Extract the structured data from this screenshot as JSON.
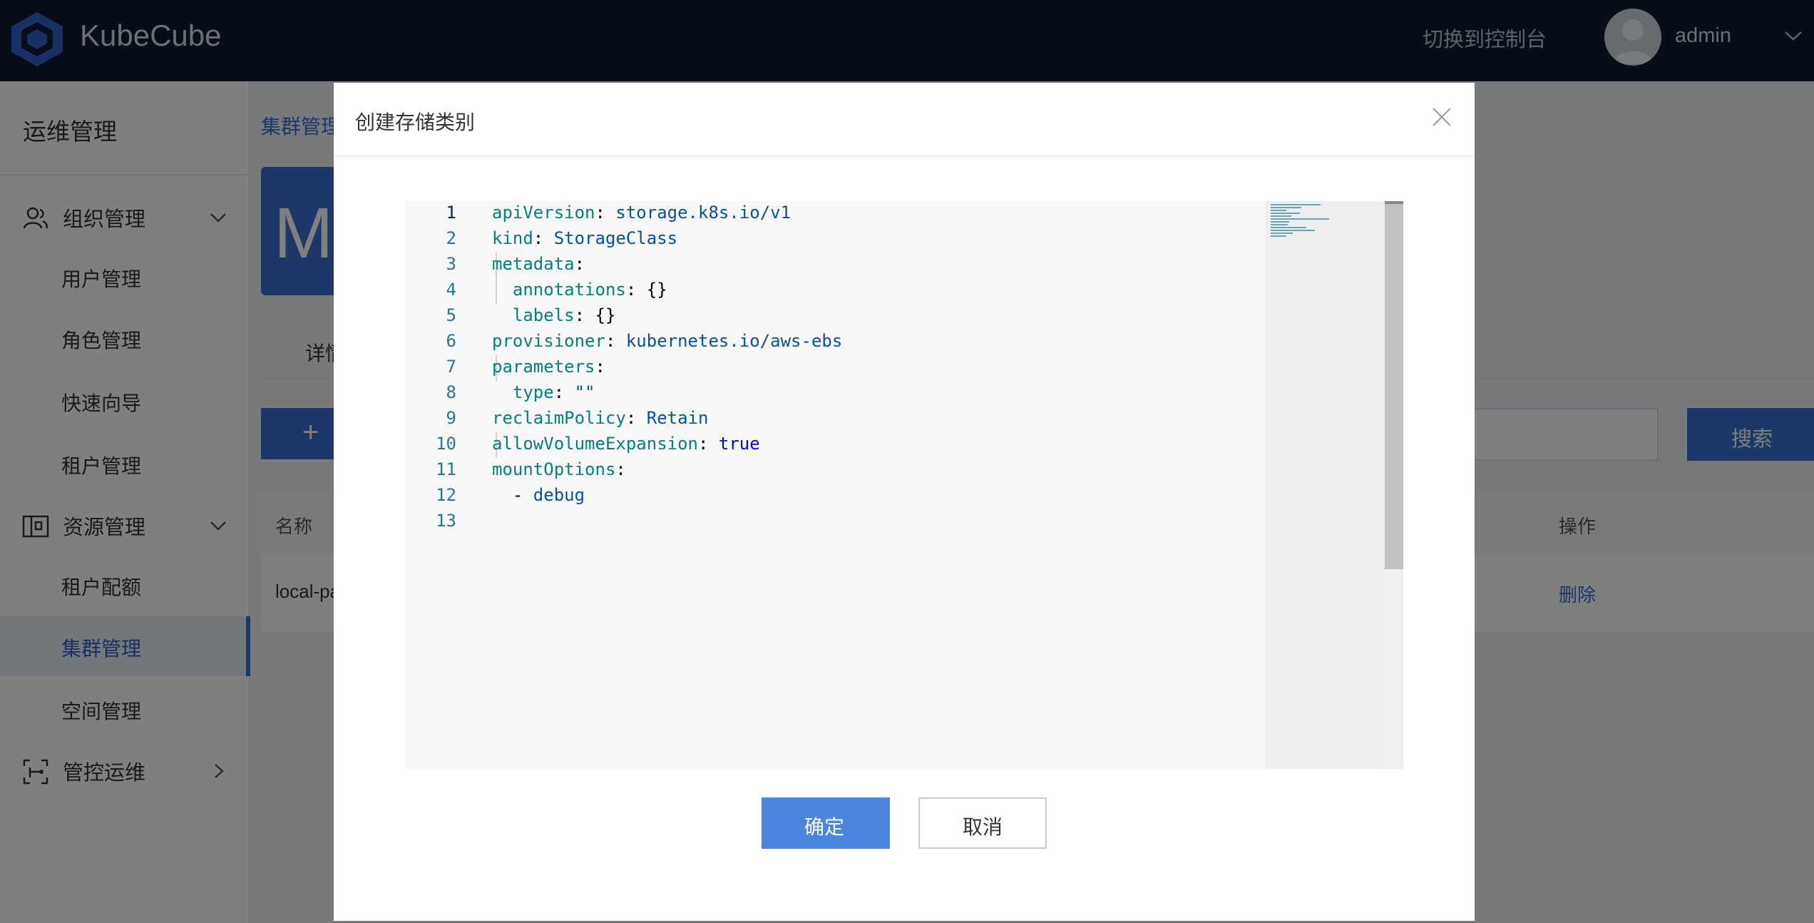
{
  "header": {
    "brand": "KubeCube",
    "console_link": "切换到控制台",
    "username": "admin"
  },
  "sidebar": {
    "title": "运维管理",
    "groups": [
      {
        "label": "组织管理",
        "icon": "users-icon"
      },
      {
        "label": "资源管理",
        "icon": "resource-icon"
      },
      {
        "label": "管控运维",
        "icon": "ops-icon"
      }
    ],
    "items": [
      {
        "label": "用户管理"
      },
      {
        "label": "角色管理"
      },
      {
        "label": "快速向导"
      },
      {
        "label": "租户管理"
      },
      {
        "label": "租户配额"
      },
      {
        "label": "集群管理",
        "active": true
      },
      {
        "label": "空间管理"
      }
    ]
  },
  "main": {
    "breadcrumb": "集群管理",
    "card_letter": "M",
    "tab": "详情",
    "add_label": "+",
    "search_button": "搜索",
    "table": {
      "columns": [
        "名称",
        "操作"
      ],
      "rows": [
        {
          "name": "local-path",
          "action": "删除"
        }
      ]
    }
  },
  "modal": {
    "title": "创建存储类别",
    "confirm": "确定",
    "cancel": "取消",
    "editor": {
      "line_numbers": [
        "1",
        "2",
        "3",
        "4",
        "5",
        "6",
        "7",
        "8",
        "9",
        "10",
        "11",
        "12",
        "13"
      ],
      "lines": [
        [
          {
            "t": "apiVersion",
            "c": "k"
          },
          {
            "t": ": ",
            "c": "p"
          },
          {
            "t": "storage.k8s.io/v1",
            "c": "v"
          }
        ],
        [
          {
            "t": "kind",
            "c": "k"
          },
          {
            "t": ": ",
            "c": "p"
          },
          {
            "t": "StorageClass",
            "c": "v"
          }
        ],
        [
          {
            "t": "metadata",
            "c": "k"
          },
          {
            "t": ":",
            "c": "p"
          }
        ],
        [
          {
            "t": "  annotations",
            "c": "k"
          },
          {
            "t": ": {}",
            "c": "p"
          }
        ],
        [
          {
            "t": "  labels",
            "c": "k"
          },
          {
            "t": ": {}",
            "c": "p"
          }
        ],
        [
          {
            "t": "provisioner",
            "c": "k"
          },
          {
            "t": ": ",
            "c": "p"
          },
          {
            "t": "kubernetes.io/aws-ebs",
            "c": "v"
          }
        ],
        [
          {
            "t": "parameters",
            "c": "k"
          },
          {
            "t": ":",
            "c": "p"
          }
        ],
        [
          {
            "t": "  type",
            "c": "k"
          },
          {
            "t": ": ",
            "c": "p"
          },
          {
            "t": "\"\"",
            "c": "v"
          }
        ],
        [
          {
            "t": "reclaimPolicy",
            "c": "k"
          },
          {
            "t": ": ",
            "c": "p"
          },
          {
            "t": "Retain",
            "c": "v"
          }
        ],
        [
          {
            "t": "allowVolumeExpansion",
            "c": "k"
          },
          {
            "t": ": ",
            "c": "p"
          },
          {
            "t": "true",
            "c": "b"
          }
        ],
        [
          {
            "t": "mountOptions",
            "c": "k"
          },
          {
            "t": ":",
            "c": "p"
          }
        ],
        [
          {
            "t": "  - ",
            "c": "p"
          },
          {
            "t": "debug",
            "c": "v"
          }
        ],
        []
      ]
    }
  },
  "colors": {
    "header_bg": "#0f1c2e",
    "accent": "#3a6fd1",
    "confirm_bg": "#4a86e0",
    "yaml_key": "#008080",
    "yaml_value": "#0451a5",
    "yaml_bool": "#0000ff"
  }
}
